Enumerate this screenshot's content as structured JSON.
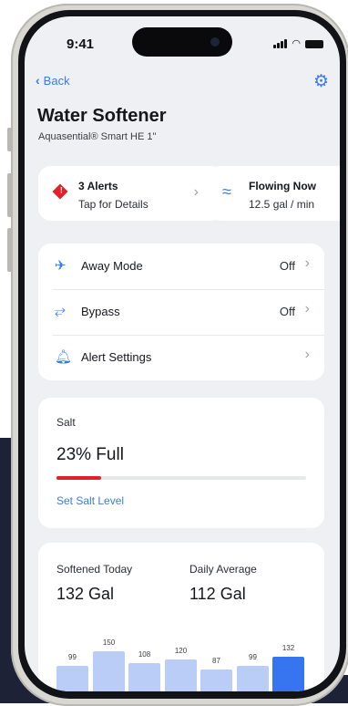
{
  "status": {
    "time": "9:41"
  },
  "nav": {
    "back_label": "Back"
  },
  "device": {
    "title": "Water Softener",
    "model": "Aquasential® Smart HE 1\""
  },
  "alerts_card": {
    "title": "3 Alerts",
    "subtitle": "Tap for Details"
  },
  "flow_card": {
    "title": "Flowing Now",
    "subtitle": "12.5 gal / min"
  },
  "settings_list": [
    {
      "label": "Away Mode",
      "value": "Off",
      "icon": "airplane-icon"
    },
    {
      "label": "Bypass",
      "value": "Off",
      "icon": "bypass-icon"
    },
    {
      "label": "Alert Settings",
      "value": "",
      "icon": "bell-icon"
    }
  ],
  "salt": {
    "label": "Salt",
    "value_text": "23% Full",
    "level_percent": 23,
    "link_label": "Set Salt Level"
  },
  "stats": {
    "softened_today_label": "Softened Today",
    "softened_today_value": "132 Gal",
    "daily_average_label": "Daily Average",
    "daily_average_value": "112 Gal"
  },
  "colors": {
    "accent": "#3b7be8",
    "alert": "#e3202a",
    "bar_light": "#b9cdf6",
    "bar_current": "#3775f0"
  },
  "chart_data": {
    "type": "bar",
    "categories": [
      "",
      "",
      "",
      "",
      "",
      "",
      ""
    ],
    "values": [
      99,
      150,
      108,
      120,
      87,
      99,
      132
    ],
    "highlight_index": 6,
    "ylim": [
      0,
      160
    ]
  }
}
